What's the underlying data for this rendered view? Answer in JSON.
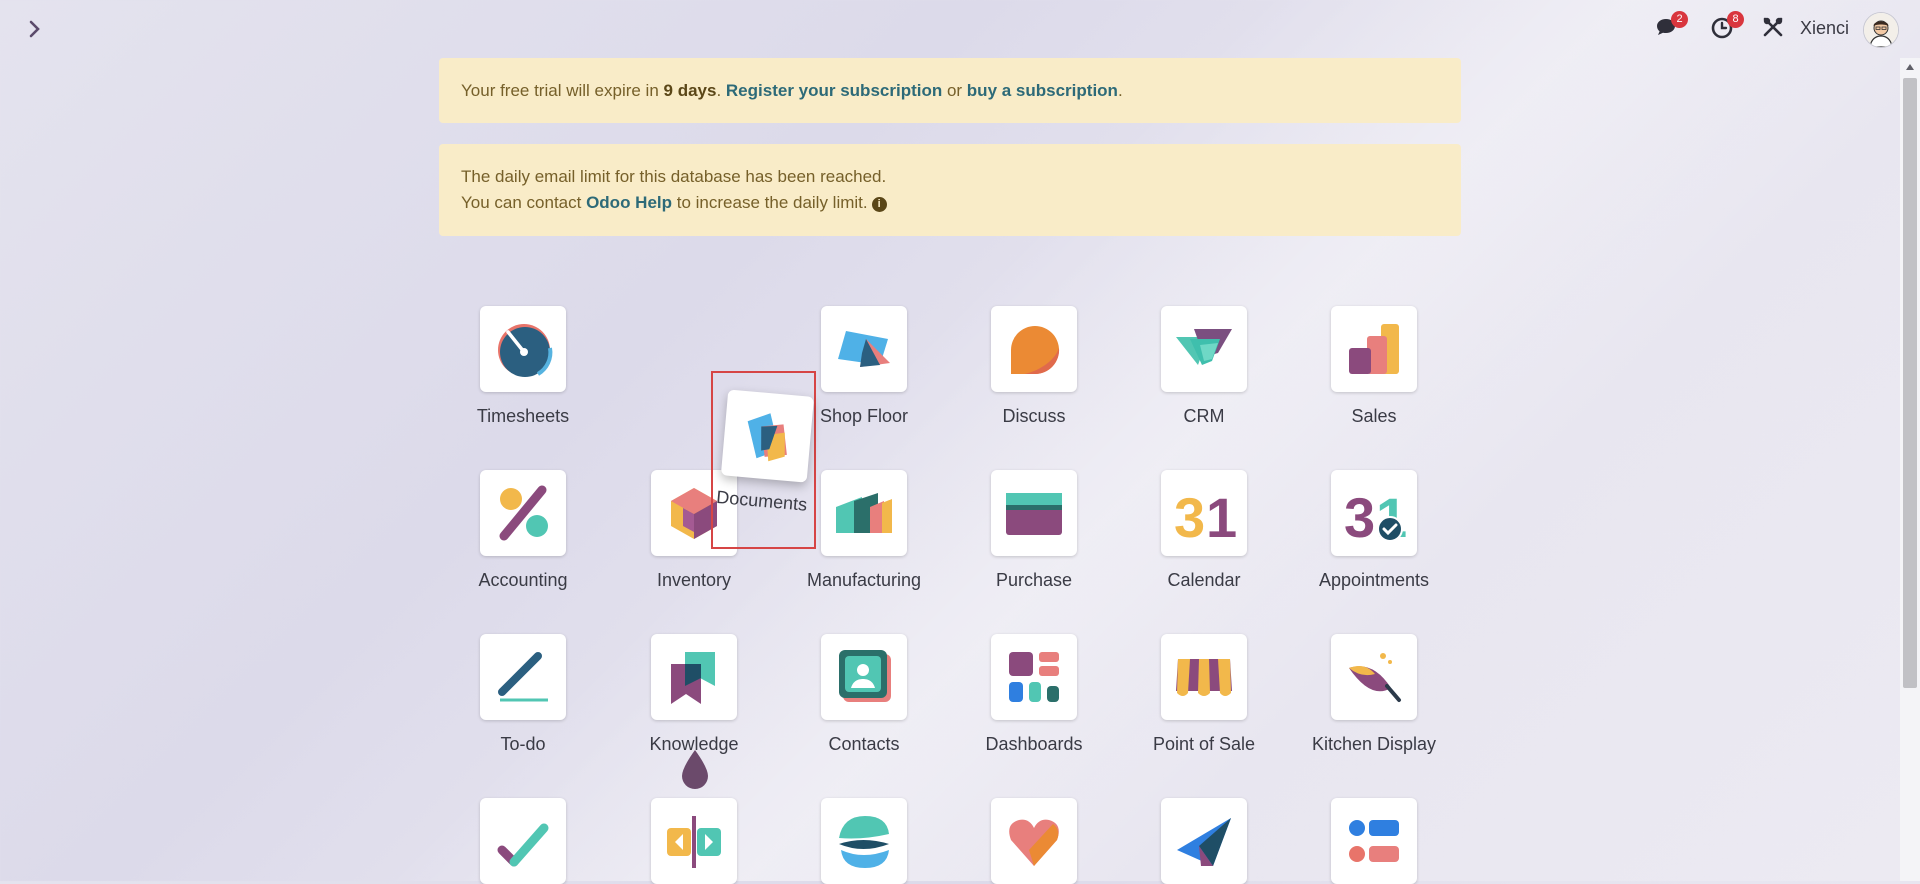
{
  "topbar": {
    "username": "Xienci",
    "messages_badge": "2",
    "activities_badge": "8"
  },
  "alerts": {
    "trial": {
      "prefix": "Your free trial will expire in ",
      "days": "9 days",
      "sep1": ". ",
      "register_link": "Register your subscription",
      "or": " or ",
      "buy_link": "buy a subscription",
      "end": "."
    },
    "email": {
      "line1": "The daily email limit for this database has been reached.",
      "line2_prefix": "You can contact ",
      "help_link": "Odoo Help",
      "line2_suffix": " to increase the daily limit."
    }
  },
  "apps": [
    {
      "name": "Timesheets",
      "icon": "timesheets-icon"
    },
    {
      "name": "Shop Floor",
      "icon": "shop-floor-icon"
    },
    {
      "name": "Discuss",
      "icon": "discuss-icon"
    },
    {
      "name": "CRM",
      "icon": "crm-icon"
    },
    {
      "name": "Sales",
      "icon": "sales-icon"
    },
    {
      "name": "Accounting",
      "icon": "accounting-icon"
    },
    {
      "name": "Inventory",
      "icon": "inventory-icon"
    },
    {
      "name": "Manufacturing",
      "icon": "manufacturing-icon"
    },
    {
      "name": "Purchase",
      "icon": "purchase-icon"
    },
    {
      "name": "Calendar",
      "icon": "calendar-icon"
    },
    {
      "name": "Appointments",
      "icon": "appointments-icon"
    },
    {
      "name": "To-do",
      "icon": "todo-icon"
    },
    {
      "name": "Knowledge",
      "icon": "knowledge-icon"
    },
    {
      "name": "Contacts",
      "icon": "contacts-icon"
    },
    {
      "name": "Dashboards",
      "icon": "dashboards-icon"
    },
    {
      "name": "Point of Sale",
      "icon": "point-of-sale-icon"
    },
    {
      "name": "Kitchen Display",
      "icon": "kitchen-display-icon"
    }
  ],
  "dragging_app": {
    "name": "Documents",
    "icon": "documents-icon"
  },
  "calendar_number": "31"
}
